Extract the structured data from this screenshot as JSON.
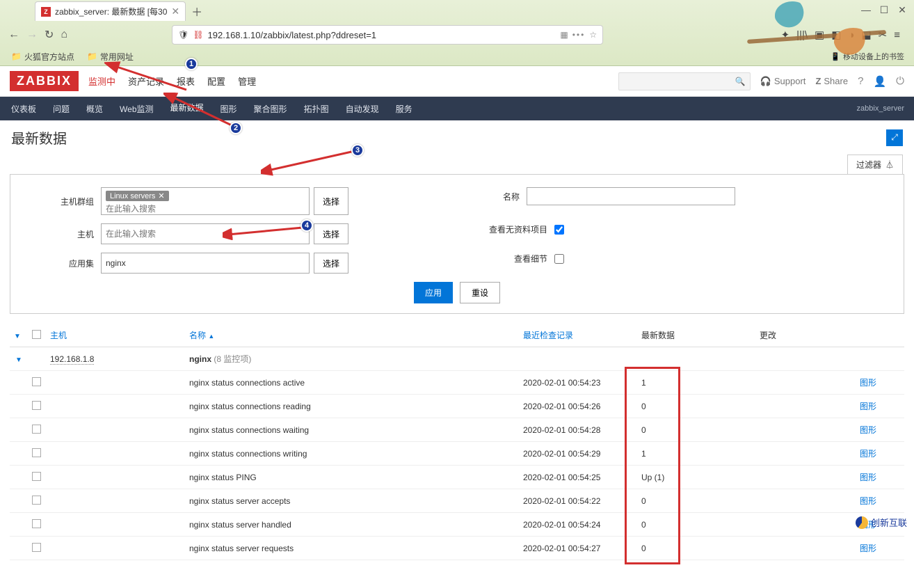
{
  "browser": {
    "tab_title": "zabbix_server: 最新数据 [每30",
    "url": "192.168.1.10/zabbix/latest.php?ddreset=1",
    "bookmarks": {
      "firefox_official": "火狐官方站点",
      "common_sites": "常用网址"
    },
    "mobile_bookmarks": "移动设备上的书签"
  },
  "header": {
    "logo": "ZABBIX",
    "topnav": {
      "monitoring": "监测中",
      "inventory": "资产记录",
      "reports": "报表",
      "configuration": "配置",
      "administration": "管理"
    },
    "support": "Support",
    "share": "Share"
  },
  "subnav": {
    "dashboard": "仪表板",
    "problems": "问题",
    "overview": "概览",
    "web": "Web监测",
    "latest": "最新数据",
    "graphs": "图形",
    "screens": "聚合图形",
    "maps": "拓扑图",
    "discovery": "自动发现",
    "services": "服务",
    "server_label": "zabbix_server"
  },
  "page": {
    "title": "最新数据",
    "filter_tab": "过滤器",
    "fullscreen": "⤢"
  },
  "filter": {
    "labels": {
      "hostgroups": "主机群组",
      "hosts": "主机",
      "application": "应用集",
      "name": "名称",
      "show_without_data": "查看无资料项目",
      "show_details": "查看细节"
    },
    "placeholders": {
      "search": "在此输入搜索"
    },
    "values": {
      "hostgroup_tag": "Linux servers",
      "application": "nginx",
      "show_without_data": true,
      "show_details": false
    },
    "buttons": {
      "select": "选择",
      "apply": "应用",
      "reset": "重设"
    }
  },
  "badges": {
    "b1": "1",
    "b2": "2",
    "b3": "3",
    "b4": "4"
  },
  "table": {
    "headers": {
      "host": "主机",
      "name": "名称",
      "last_check": "最近检查记录",
      "last_data": "最新数据",
      "change": "更改"
    },
    "group": {
      "host": "192.168.1.8",
      "app": "nginx",
      "count_label": "(8 监控项)"
    },
    "graph_link": "图形",
    "rows": [
      {
        "name": "nginx status connections active",
        "check": "2020-02-01 00:54:23",
        "data": "1"
      },
      {
        "name": "nginx status connections reading",
        "check": "2020-02-01 00:54:26",
        "data": "0"
      },
      {
        "name": "nginx status connections waiting",
        "check": "2020-02-01 00:54:28",
        "data": "0"
      },
      {
        "name": "nginx status connections writing",
        "check": "2020-02-01 00:54:29",
        "data": "1"
      },
      {
        "name": "nginx status PING",
        "check": "2020-02-01 00:54:25",
        "data": "Up (1)"
      },
      {
        "name": "nginx status server accepts",
        "check": "2020-02-01 00:54:22",
        "data": "0"
      },
      {
        "name": "nginx status server handled",
        "check": "2020-02-01 00:54:24",
        "data": "0"
      },
      {
        "name": "nginx status server requests",
        "check": "2020-02-01 00:54:27",
        "data": "0"
      }
    ]
  },
  "footer": {
    "brand": "创新互联"
  }
}
